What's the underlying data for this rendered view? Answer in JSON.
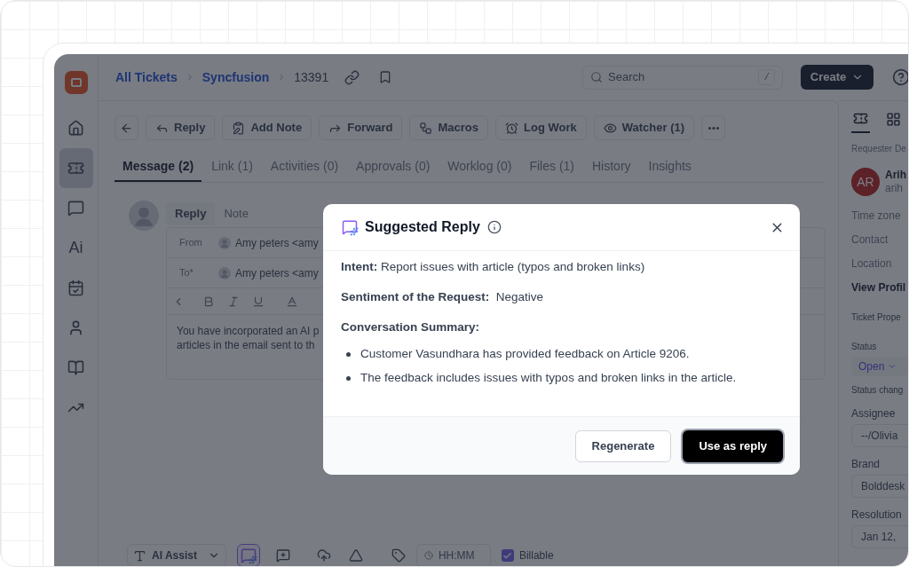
{
  "breadcrumb": [
    {
      "label": "All Tickets",
      "kind": "link"
    },
    {
      "label": "Syncfusion",
      "kind": "link"
    },
    {
      "label": "13391",
      "kind": "current"
    }
  ],
  "search": {
    "placeholder": "Search",
    "shortcut": "/"
  },
  "create_button": "Create",
  "rail": [
    {
      "kind": "icon",
      "selected": false
    },
    {
      "kind": "icon",
      "selected": true
    },
    {
      "kind": "icon",
      "selected": false
    },
    {
      "kind": "text",
      "label": "Ai",
      "selected": false
    },
    {
      "kind": "icon",
      "selected": false
    },
    {
      "kind": "icon",
      "selected": false
    },
    {
      "kind": "icon",
      "selected": false
    },
    {
      "kind": "icon",
      "selected": false
    }
  ],
  "toolbar": [
    "Reply",
    "Add Note",
    "Forward",
    "Macros",
    "Log Work",
    "Watcher (1)"
  ],
  "tabs": [
    {
      "label": "Message (2)",
      "selected": true
    },
    {
      "label": "Link (1)",
      "selected": false
    },
    {
      "label": "Activities (0)",
      "selected": false
    },
    {
      "label": "Approvals (0)",
      "selected": false
    },
    {
      "label": "Worklog (0)",
      "selected": false
    },
    {
      "label": "Files (1)",
      "selected": false
    },
    {
      "label": "History",
      "selected": false
    },
    {
      "label": "Insights",
      "selected": false
    }
  ],
  "composer": {
    "tabs": [
      {
        "label": "Reply",
        "selected": true
      },
      {
        "label": "Note",
        "selected": false
      }
    ],
    "from_label": "From",
    "from_value": "Amy peters <amy",
    "to_label": "To*",
    "to_value": "Amy peters <amy",
    "body_lines": [
      "You have incorporated an AI p",
      "articles in the email sent to th"
    ]
  },
  "bottom_bar": {
    "ai_assist": "AI Assist",
    "suggested_reply_active": true,
    "time_placeholder": "HH:MM",
    "billable": {
      "label": "Billable",
      "checked": true
    }
  },
  "right_panel": {
    "section_label": "Requester De",
    "avatar_initials": "AR",
    "name": "Arih",
    "email": "arih",
    "fields": [
      "Time zone",
      "Contact",
      "Location"
    ],
    "profile_link": "View Profil",
    "properties_label": "Ticket Prope",
    "status_label": "Status",
    "status_value": "Open",
    "status_note": "Status chang",
    "props": [
      {
        "label": "Assignee",
        "value": "--/Olivia"
      },
      {
        "label": "Brand",
        "value": "Bolddesk"
      },
      {
        "label": "Resolution",
        "value": "Jan 12,"
      }
    ]
  },
  "modal": {
    "title": "Suggested Reply",
    "intent": "**Intent:** Report issues with article (typos and broken links)",
    "sentiment": "**Sentiment of the Request:**  Negative",
    "summary_label": "Conversation Summary:",
    "summary": [
      "Customer Vasundhara has provided feedback on Article 9206.",
      "The feedback includes issues with typos and broken links in the article."
    ],
    "buttons": [
      {
        "label": "Regenerate",
        "kind": "secondary"
      },
      {
        "label": "Use as reply",
        "kind": "primary"
      }
    ]
  }
}
